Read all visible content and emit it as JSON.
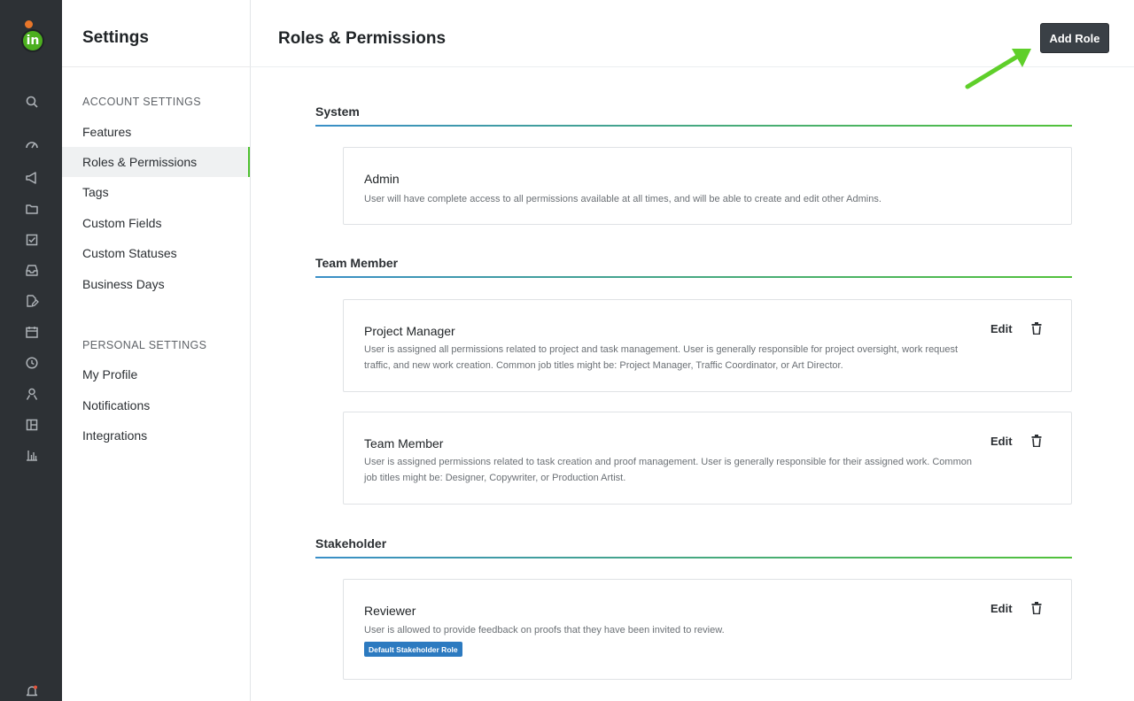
{
  "rail": {
    "logo_text": "in",
    "icons": [
      "search-icon",
      "dashboard-gauge-icon",
      "megaphone-icon",
      "folder-icon",
      "task-check-icon",
      "inbox-icon",
      "proof-edit-icon",
      "calendar-icon",
      "clock-icon",
      "user-icon",
      "layout-icon",
      "reports-chart-icon",
      "notifications-bell-icon"
    ]
  },
  "sidebar": {
    "title": "Settings",
    "account_label": "ACCOUNT SETTINGS",
    "account_items": [
      "Features",
      "Roles & Permissions",
      "Tags",
      "Custom Fields",
      "Custom Statuses",
      "Business Days"
    ],
    "active_item": "Roles & Permissions",
    "personal_label": "PERSONAL SETTINGS",
    "personal_items": [
      "My Profile",
      "Notifications",
      "Integrations"
    ]
  },
  "header": {
    "title": "Roles & Permissions",
    "add_button": "Add Role"
  },
  "groups": [
    {
      "title": "System",
      "roles": [
        {
          "name": "Admin",
          "description": "User will have complete access to all permissions available at all times, and will be able to create and edit other Admins."
        }
      ]
    },
    {
      "title": "Team Member",
      "roles": [
        {
          "name": "Project Manager",
          "description": "User is assigned all permissions related to project and task management. User is generally responsible for project oversight, work request traffic, and new work creation. Common job titles might be: Project Manager, Traffic Coordinator, or Art Director.",
          "edit": "Edit"
        },
        {
          "name": "Team Member",
          "description": "User is assigned permissions related to task creation and proof management. User is generally responsible for their assigned work. Common job titles might be: Designer, Copywriter, or Production Artist.",
          "edit": "Edit"
        }
      ]
    },
    {
      "title": "Stakeholder",
      "roles": [
        {
          "name": "Reviewer",
          "description": "User is allowed to provide feedback on proofs that they have been invited to review.",
          "edit": "Edit",
          "badge": "Default Stakeholder Role"
        }
      ]
    }
  ],
  "colors": {
    "rail_bg": "#2d3135",
    "accent_green": "#4fc130",
    "button_dark": "#3a4046",
    "badge_blue": "#2c7ac0",
    "divider_blue": "#3a8fc8"
  }
}
